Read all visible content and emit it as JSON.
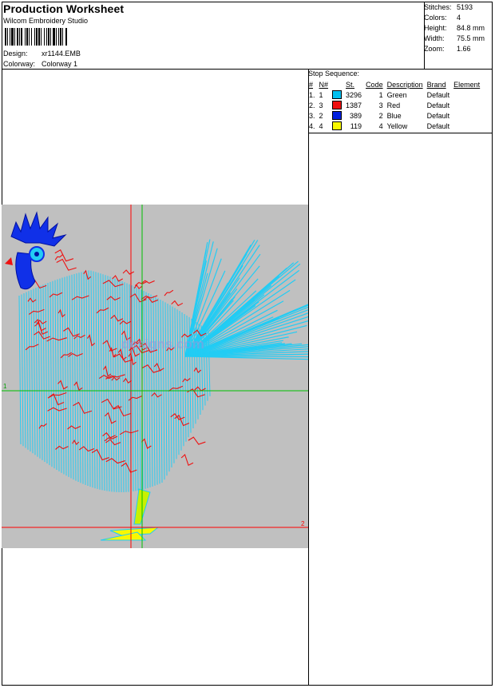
{
  "header": {
    "title": "Production Worksheet",
    "software": "Wilcom  Embroidery Studio"
  },
  "design_info": {
    "design_label": "Design:",
    "design_value": "xr1144.EMB",
    "colorway_label": "Colorway:",
    "colorway_value": "Colorway 1"
  },
  "stats": [
    {
      "label": "Stitches:",
      "value": "5193"
    },
    {
      "label": "Colors:",
      "value": "4"
    },
    {
      "label": "Height:",
      "value": "84.8 mm"
    },
    {
      "label": "Width:",
      "value": "75.5 mm"
    },
    {
      "label": "Zoom:",
      "value": "1.66"
    }
  ],
  "stop_sequence": {
    "title": "Stop Sequence:",
    "headers": [
      "#",
      "N#",
      "St.",
      "Code",
      "Description",
      "Brand",
      "Element"
    ],
    "rows": [
      {
        "num": "1.",
        "n": "1",
        "color": "#00c0f0",
        "stitches": "3296",
        "code": "1",
        "description": "Green",
        "brand": "Default",
        "element": ""
      },
      {
        "num": "2.",
        "n": "3",
        "color": "#f01010",
        "stitches": "1387",
        "code": "3",
        "description": "Red",
        "brand": "Default",
        "element": ""
      },
      {
        "num": "3.",
        "n": "2",
        "color": "#0020e0",
        "stitches": "389",
        "code": "2",
        "description": "Blue",
        "brand": "Default",
        "element": ""
      },
      {
        "num": "4.",
        "n": "4",
        "color": "#f8f800",
        "stitches": "119",
        "code": "4",
        "description": "Yellow",
        "brand": "Default",
        "element": ""
      }
    ]
  },
  "canvas": {
    "background": "#c0c0c0",
    "crosshair_red": "#ff0000",
    "crosshair_green": "#00c000",
    "marker_1": "1",
    "marker_2": "2",
    "watermark": "designs.com"
  }
}
